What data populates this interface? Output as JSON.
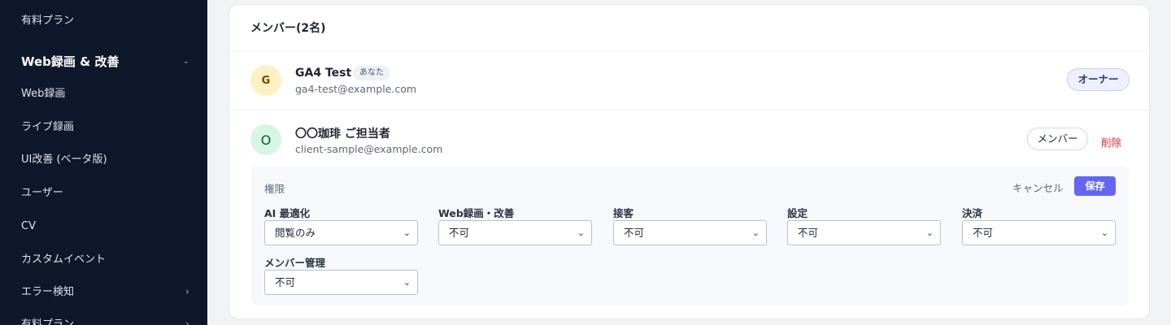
{
  "sidebar": {
    "items_top": [
      {
        "label": "有料プラン"
      }
    ],
    "section": {
      "label": "Web録画 & 改善",
      "chevron": "chevron-down-icon"
    },
    "items": [
      {
        "label": "Web録画"
      },
      {
        "label": "ライブ録画"
      },
      {
        "label": "UI改善 (ベータ版)"
      },
      {
        "label": "ユーザー"
      },
      {
        "label": "CV"
      },
      {
        "label": "カスタムイベント"
      },
      {
        "label": "エラー検知",
        "chevron": "chevron-right-icon"
      },
      {
        "label": "有料プラン",
        "chevron": "chevron-right-icon"
      }
    ]
  },
  "members": {
    "title": "メンバー(2名)",
    "list": [
      {
        "initial": "G",
        "name": "GA4 Test",
        "badge": "あなた",
        "email": "ga4-test@example.com",
        "role": "オーナー"
      },
      {
        "initial": "O",
        "name": "〇〇珈琲 ご担当者",
        "email": "client-sample@example.com",
        "role": "メンバー",
        "delete_label": "削除"
      }
    ]
  },
  "permissions": {
    "title": "権限",
    "cancel_label": "キャンセル",
    "save_label": "保存",
    "fields": [
      {
        "label": "AI 最適化",
        "value": "閲覧のみ"
      },
      {
        "label": "Web録画・改善",
        "value": "不可"
      },
      {
        "label": "接客",
        "value": "不可"
      },
      {
        "label": "設定",
        "value": "不可"
      },
      {
        "label": "決済",
        "value": "不可"
      },
      {
        "label": "メンバー管理",
        "value": "不可"
      }
    ]
  },
  "colors": {
    "sidebar_bg": "#0f172a",
    "accent": "#6366f1",
    "danger": "#d12a3b"
  }
}
